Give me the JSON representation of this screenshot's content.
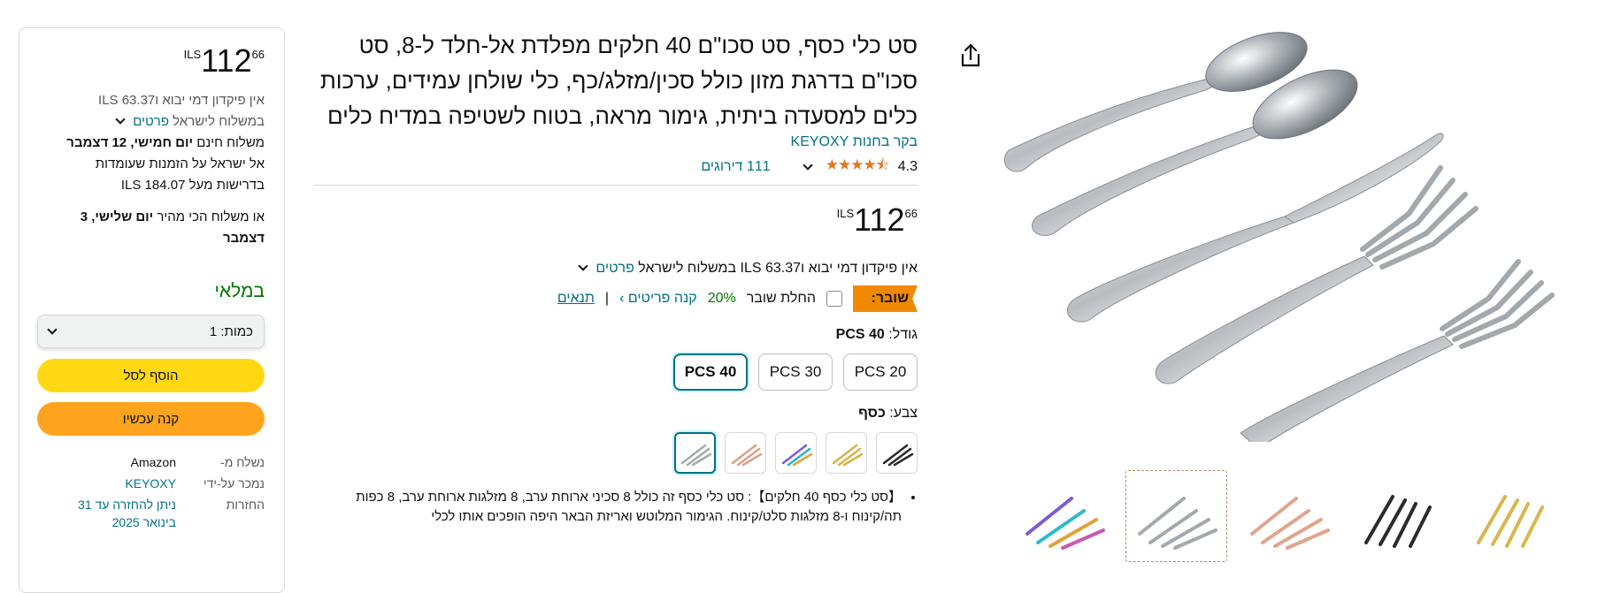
{
  "buybox": {
    "price": {
      "currency": "ILS",
      "whole": "112",
      "fraction": "66"
    },
    "import_line": "אין פיקדון דמי יבוא ו63.37 ILS",
    "shipping_prefix": "במשלוח לישראל",
    "details_link": "פרטים",
    "free_delivery_prefix": "משלוח חינם",
    "free_delivery_date": "יום חמישי, 12 דצמבר",
    "free_delivery_line2": "אל ישראל על הזמנות שעומדות",
    "free_delivery_line3": "בדרישות מעל 184.07 ILS",
    "fastest_prefix": "או משלוח הכי מהיר",
    "fastest_date": "יום שלישי, 3 דצמבר",
    "in_stock": "במלאי",
    "quantity_label": "כמות:",
    "quantity_value": "1",
    "add_to_cart": "הוסף לסל",
    "buy_now": "קנה עכשיו",
    "meta": [
      {
        "key": "נשלח מ-",
        "value": "Amazon"
      },
      {
        "key": "נמכר על-ידי",
        "value": "KEYOXY"
      },
      {
        "key": "החזרות",
        "value": "ניתן להחזרה עד 31 בינואר 2025"
      }
    ]
  },
  "product": {
    "title": "סט כלי כסף, סט סכו\"ם 40 חלקים מפלדת אל-חלד ל-8, סט סכו\"ם בדרגת מזון כולל סכין/מזלג/כף, כלי שולחן עמידים, ערכות כלים למסעדה ביתית, גימור מראה, בטוח לשטיפה במדיח כלים",
    "store_link": "בקר בחנות KEYOXY",
    "rating_value": "4.3",
    "rating_count": "111 דירוגים",
    "price": {
      "currency": "ILS",
      "whole": "112",
      "fraction": "66"
    },
    "import_line": "אין פיקדון דמי יבוא ו63.37 ILS במשלוח לישראל",
    "details_link": "פרטים",
    "coupon": {
      "tag": "שובר:",
      "apply_label": "החלת שובר",
      "percent": "20%",
      "shop_items": "קנה פריטים ›",
      "separator": "|",
      "terms": "תנאים"
    },
    "size": {
      "label": "גודל:",
      "selected": "40 PCS",
      "options": [
        "20 PCS",
        "30 PCS",
        "40 PCS"
      ]
    },
    "color": {
      "label": "צבע:",
      "selected": "כסף",
      "swatches": [
        "black",
        "gold",
        "rainbow",
        "rose-gold",
        "silver"
      ]
    },
    "bullet_1": "【סט כלי כסף 40 חלקים】: סט כלי כסף זה כולל 8 סכיני ארוחת ערב, 8 מזלגות ארוחת ערב, 8 כפות תה/קינוח ו-8 מזלגות סלט/קינוח. הגימור המלוטש ואריזת הבאר היפה הופכים אותו לכלי"
  },
  "gallery": {
    "thumbnails": [
      "rainbow",
      "silver",
      "rose-gold",
      "black",
      "gold"
    ],
    "selected_thumbnail": "silver"
  },
  "colors": {
    "link": "#007185",
    "in_stock": "#007600",
    "add_to_cart": "#ffd814",
    "buy_now": "#ffa41c",
    "coupon": "#f08804",
    "stars": "#de7921"
  }
}
